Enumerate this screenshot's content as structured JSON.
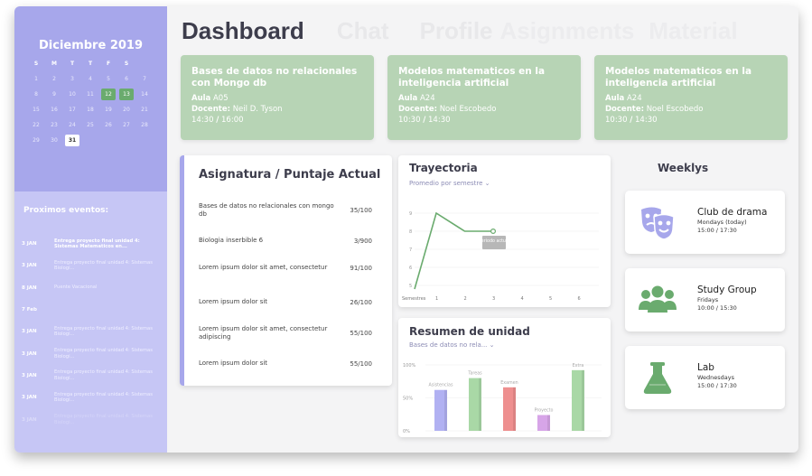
{
  "calendar": {
    "month": "Diciembre 2019",
    "weekdays": [
      "S",
      "M",
      "T",
      "T",
      "F",
      "S"
    ],
    "rows": [
      [
        "1",
        "2",
        "3",
        "4",
        "5",
        "6",
        "7"
      ],
      [
        "8",
        "9",
        "10",
        "11",
        "12",
        "13",
        "14"
      ],
      [
        "15",
        "16",
        "17",
        "18",
        "19",
        "20",
        "21"
      ],
      [
        "22",
        "23",
        "24",
        "25",
        "26",
        "27",
        "28"
      ],
      [
        "29",
        "30",
        "31"
      ]
    ],
    "highlighted": [
      "12",
      "13"
    ],
    "today": "31"
  },
  "events": {
    "title": "Proximos eventos:",
    "items": [
      {
        "date": "3 JAN",
        "text": "Entrega proyecto final unidad 4: Sistemas Matematicos en..."
      },
      {
        "date": "3 JAN",
        "text": "Entrega proyecto final unidad 4: Sistemas Biologi..."
      },
      {
        "date": "8 JAN",
        "text": "Puente Vacacional"
      },
      {
        "date": "7 Feb",
        "text": ""
      },
      {
        "date": "3 JAN",
        "text": "Entrega proyecto final unidad 4: Sistemas Biologi..."
      },
      {
        "date": "3 JAN",
        "text": "Entrega proyecto final unidad 4: Sistemas Biologi..."
      },
      {
        "date": "3 JAN",
        "text": "Entrega proyecto final unidad 4: Sistemas Biologi..."
      },
      {
        "date": "3 JAN",
        "text": "Entrega proyecto final unidad 4: Sistemas Biologi..."
      },
      {
        "date": "3 JAN",
        "text": "Entrega proyecto final unidad 4: Sistemas Biologi..."
      }
    ]
  },
  "tabs": [
    "Dashboard",
    "Chat",
    "Profile",
    "Asignments",
    "Material"
  ],
  "classes": [
    {
      "title": "Bases de datos no relacionales con Mongo db",
      "aula_label": "Aula",
      "aula": "A05",
      "docente_label": "Docente:",
      "docente": "Neil D. Tyson",
      "start": "14:30",
      "sep": "/",
      "end": "16:00"
    },
    {
      "title": "Modelos matematicos en la inteligencia artificial",
      "aula_label": "Aula",
      "aula": "A24",
      "docente_label": "Docente:",
      "docente": "Noel Escobedo",
      "start": "10:30",
      "sep": "/",
      "end": "14:30"
    },
    {
      "title": "Modelos matematicos en la inteligencia artificial",
      "aula_label": "Aula",
      "aula": "A24",
      "docente_label": "Docente:",
      "docente": "Noel Escobedo",
      "start": "10:30",
      "sep": "/",
      "end": "14:30"
    }
  ],
  "grades": {
    "title": "Asignatura / Puntaje Actual",
    "rows": [
      {
        "name": "Bases de datos no relacionales con mongo db",
        "score": "35/100"
      },
      {
        "name": "Biologia inserbible 6",
        "score": "3/900"
      },
      {
        "name": "Lorem ipsum dolor sit amet, consectetur",
        "score": "91/100"
      },
      {
        "name": "Lorem ipsum dolor sit",
        "score": "26/100"
      },
      {
        "name": "Lorem ipsum dolor sit amet, consectetur adipiscing",
        "score": "55/100"
      },
      {
        "name": "Lorem ipsum dolor sit",
        "score": "55/100"
      }
    ]
  },
  "trajectory": {
    "title": "Trayectoria",
    "subtitle": "Promedio por semestre ⌄",
    "tooltip": "periodo actual",
    "color": "#6aab6e"
  },
  "summary": {
    "title": "Resumen de unidad",
    "subtitle": "Bases de datos no rela... ⌄"
  },
  "chart_data": [
    {
      "type": "line",
      "title": "Trayectoria",
      "subtitle": "Promedio por semestre",
      "xlabel": "Semestres",
      "x": [
        1,
        2,
        3,
        4,
        5,
        6
      ],
      "y_ticks": [
        5,
        6,
        7,
        8,
        9
      ],
      "ylim": [
        4.8,
        9.2
      ],
      "series": [
        {
          "values": [
            9,
            8,
            8
          ],
          "start_value": 4.8
        }
      ],
      "annotation": "periodo actual",
      "grid": true
    },
    {
      "type": "bar",
      "title": "Resumen de unidad",
      "categories": [
        "Asistencias",
        "Tareas",
        "Examen",
        "Proyecto",
        "Extra"
      ],
      "values": [
        62,
        80,
        66,
        24,
        92
      ],
      "colors": [
        "#b1b1f2",
        "#a9d8a6",
        "#ee8f8f",
        "#d7a5e8",
        "#a9d8a6"
      ],
      "y_ticks": [
        "0%",
        "50%",
        "100%"
      ],
      "ylim": [
        0,
        100
      ]
    }
  ],
  "weeklys": {
    "title": "Weeklys",
    "items": [
      {
        "name": "Club de drama",
        "day": "Mondays (today)",
        "time": "15:00 / 17:30",
        "icon": "drama-masks-icon",
        "color": "#a7a7eb"
      },
      {
        "name": "Study Group",
        "day": "Fridays",
        "time": "10:00 / 15:30",
        "icon": "group-icon",
        "color": "#6aab6e"
      },
      {
        "name": "Lab",
        "day": "Wednesdays",
        "time": "15:00 / 17:30",
        "icon": "flask-icon",
        "color": "#6aab6e"
      }
    ]
  }
}
